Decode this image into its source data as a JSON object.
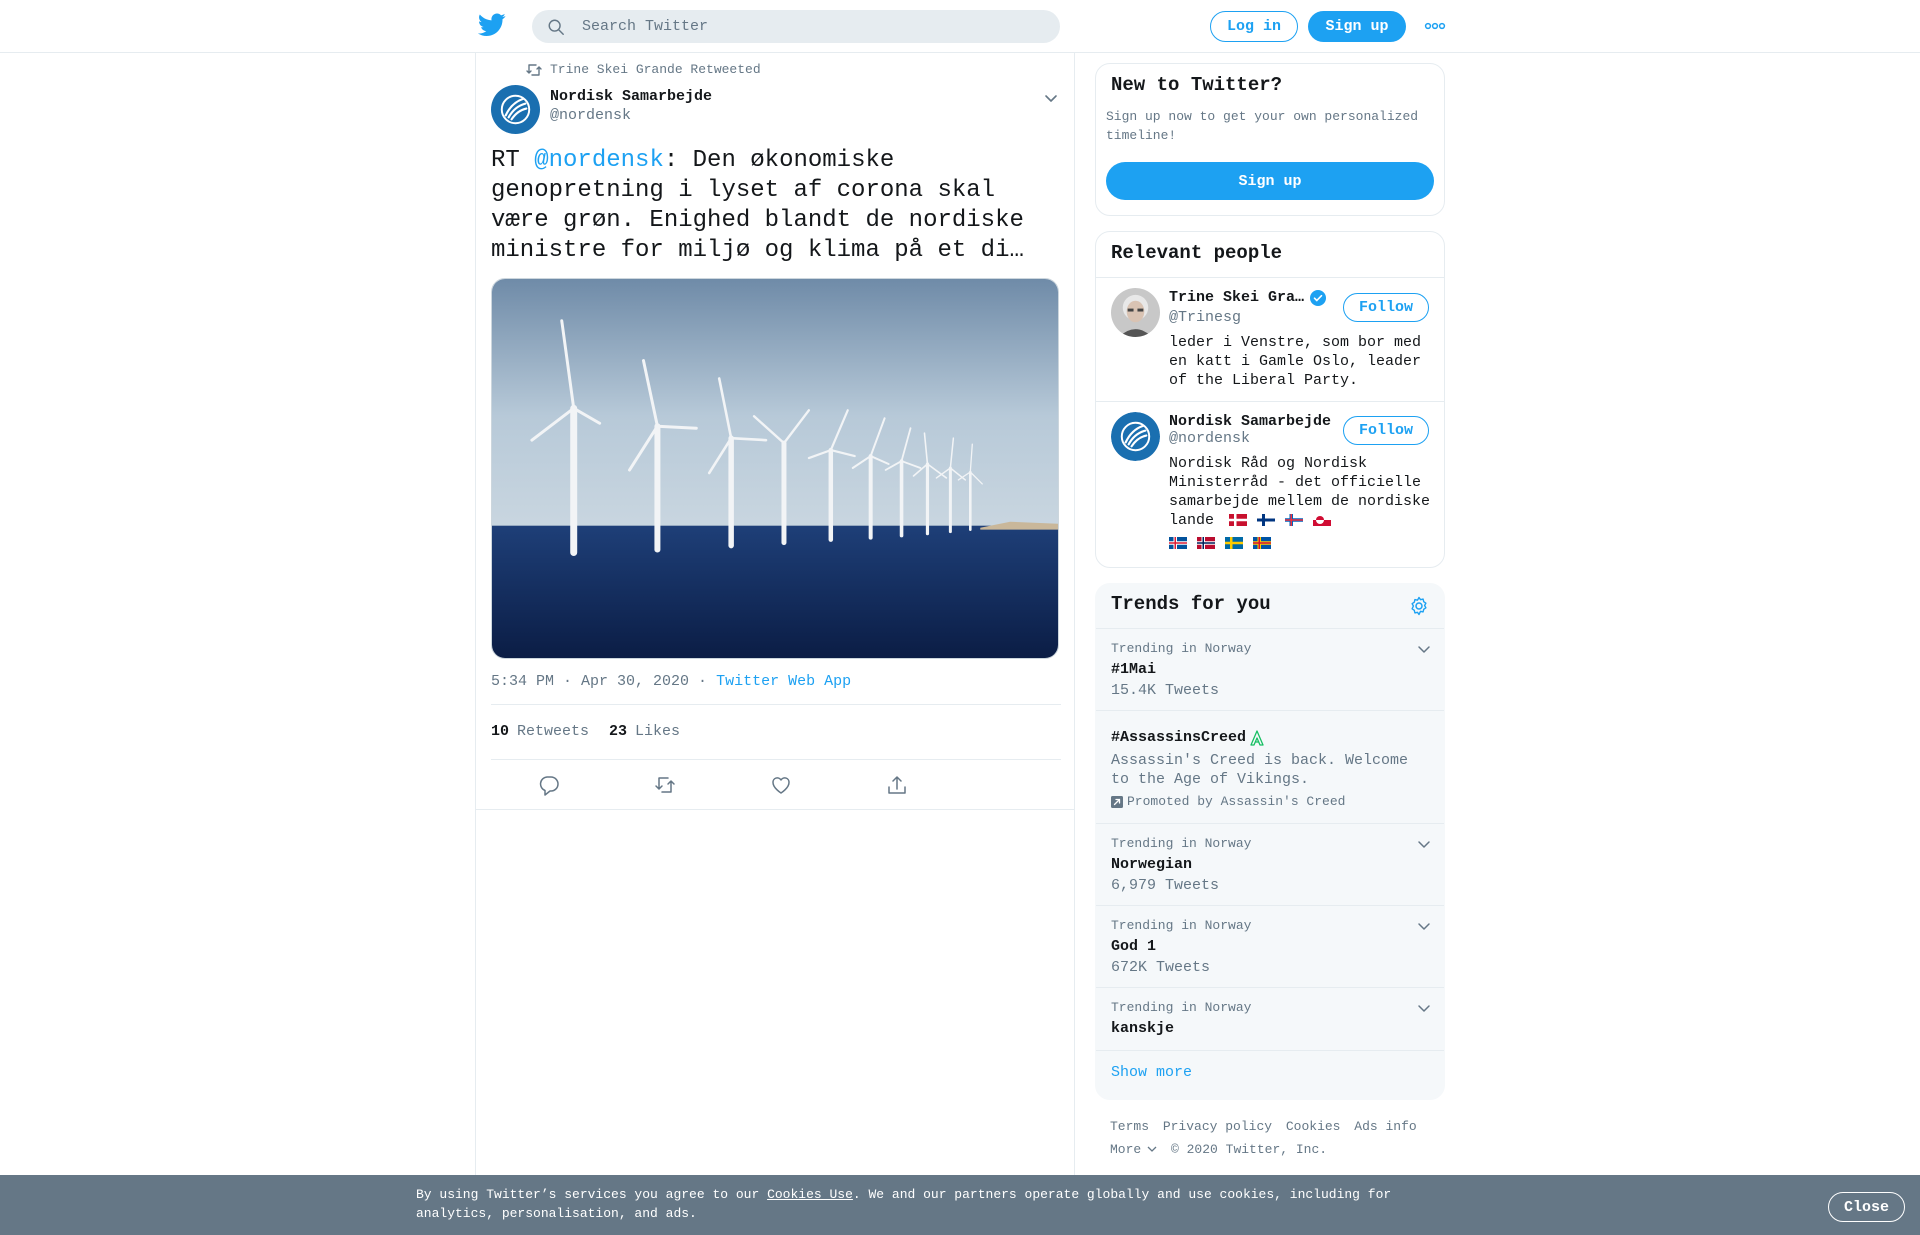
{
  "header": {
    "search_placeholder": "Search Twitter",
    "login_label": "Log in",
    "signup_label": "Sign up"
  },
  "tweet": {
    "retweeted_by": "Trine Skei Grande Retweeted",
    "author_name": "Nordisk Samarbejde",
    "author_handle": "@nordensk",
    "text_prefix": "RT ",
    "text_mention": "@nordensk",
    "text_body": ": Den økonomiske genopretning i lyset af corona skal være grøn. Enighed blandt de nordiske ministre for miljø og klima på et di…",
    "time": "5:34 PM · Apr 30, 2020",
    "separator": " · ",
    "source": "Twitter Web App",
    "retweets_count": "10",
    "retweets_label": "Retweets",
    "likes_count": "23",
    "likes_label": "Likes"
  },
  "sidebar": {
    "new_to_twitter": {
      "title": "New to Twitter?",
      "description": "Sign up now to get your own personalized timeline!",
      "button": "Sign up"
    },
    "relevant_people": {
      "title": "Relevant people",
      "people": [
        {
          "name": "Trine Skei Gra…",
          "handle": "@Trinesg",
          "bio": "leder i Venstre, som bor med en katt i Gamle Oslo, leader of the Liberal Party.",
          "follow": "Follow",
          "verified": true
        },
        {
          "name": "Nordisk Samarbejde",
          "handle": "@nordensk",
          "bio": "Nordisk Råd og Nordisk Ministerråd - det officielle samarbejde mellem de nordiske lande",
          "follow": "Follow",
          "verified": false
        }
      ]
    },
    "trends": {
      "title": "Trends for you",
      "items": [
        {
          "context": "Trending in Norway",
          "name": "#1Mai",
          "count": "15.4K Tweets"
        },
        {
          "name": "#AssassinsCreed",
          "description": "Assassin's Creed is back. Welcome to the Age of Vikings.",
          "promoted": "Promoted by Assassin's Creed"
        },
        {
          "context": "Trending in Norway",
          "name": "Norwegian",
          "count": "6,979 Tweets"
        },
        {
          "context": "Trending in Norway",
          "name": "God 1",
          "count": "672K Tweets"
        },
        {
          "context": "Trending in Norway",
          "name": "kanskje"
        }
      ],
      "show_more": "Show more"
    },
    "footer": {
      "terms": "Terms",
      "privacy": "Privacy policy",
      "cookies": "Cookies",
      "ads": "Ads info",
      "more": "More",
      "copyright": "© 2020 Twitter, Inc."
    }
  },
  "cookie_bar": {
    "text_before": "By using Twitter’s services you agree to our ",
    "link": "Cookies Use",
    "text_after": ". We and our partners operate globally and use cookies, including for analytics, personalisation, and ads.",
    "close": "Close"
  },
  "colors": {
    "accent": "#1da1f2",
    "secondary_text": "#657786",
    "border": "#e6ecf0",
    "cookie_bar": "#657786"
  }
}
